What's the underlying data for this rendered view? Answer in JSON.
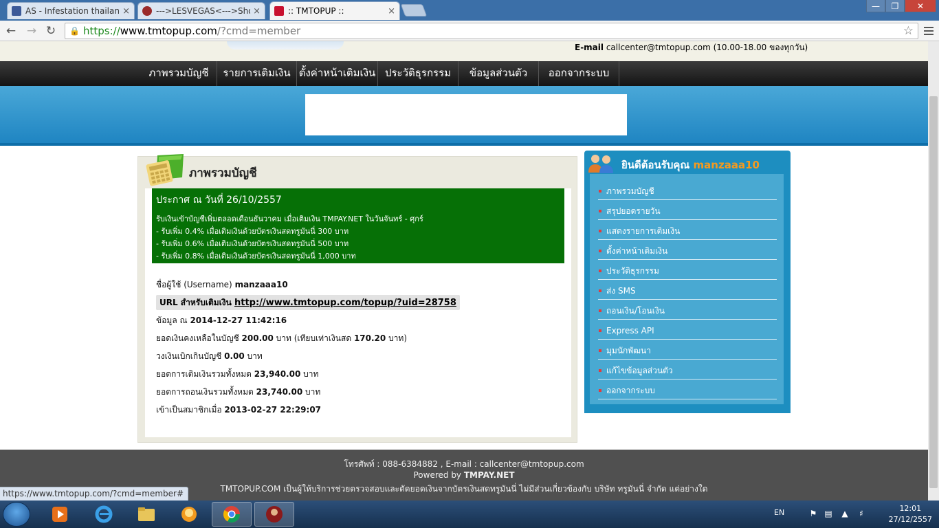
{
  "browser": {
    "tabs": [
      {
        "title": "AS - Infestation thailand",
        "favicon_color": "#3b5998",
        "active": false
      },
      {
        "title": "--->LESVEGAS<--->Sho",
        "favicon_color": "#9a2a2a",
        "active": false
      },
      {
        "title": ":: TMTOPUP ::",
        "favicon_color": "#c8102e",
        "active": true
      }
    ],
    "tab_close": "×",
    "window_buttons": {
      "minimize": "—",
      "maximize": "❐",
      "close": "✕"
    },
    "nav": {
      "back": "←",
      "forward": "→",
      "reload": "↻"
    },
    "url_scheme": "https://",
    "url_host": "www.tmtopup.com",
    "url_rest": "/?cmd=member",
    "star": "☆"
  },
  "header": {
    "email_label": "E-mail",
    "email_value": " callcenter@tmtopup.com (10.00-18.00 ของทุกวัน)"
  },
  "mainnav": [
    "ภาพรวมบัญชี",
    "รายการเติมเงิน",
    "ตั้งค่าหน้าเติมเงิน",
    "ประวัติธุรกรรม",
    "ข้อมูลส่วนตัว",
    "ออกจากระบบ"
  ],
  "overview": {
    "title": "ภาพรวมบัญชี",
    "announce": {
      "heading": "ประกาศ ณ วันที่ 26/10/2557",
      "lines": [
        "รับเงินเข้าบัญชีเพิ่มตลอดเดือนธันวาคม เมื่อเติมเงิน TMPAY.NET ในวันจันทร์ - ศุกร์",
        "- รับเพิ่ม 0.4% เมื่อเติมเงินด้วยบัตรเงินสดทรูมันนี่ 300 บาท",
        "- รับเพิ่ม 0.6% เมื่อเติมเงินด้วยบัตรเงินสดทรูมันนี่ 500 บาท",
        "- รับเพิ่ม 0.8% เมื่อเติมเงินด้วยบัตรเงินสดทรูมันนี่ 1,000 บาท"
      ]
    },
    "username_label": "ชื่อผู้ใช้ (Username) ",
    "username": "manzaaa10",
    "url_label": "URL สำหรับเติมเงิน ",
    "url_value": "http://www.tmtopup.com/topup/?uid=28758",
    "data_label": "ข้อมูล ณ ",
    "data_time": "2014-12-27 11:42:16",
    "balance_label": "ยอดเงินคงเหลือในบัญชี ",
    "balance_value": "200.00",
    "balance_unit": " บาท (เทียบเท่าเงินสด ",
    "balance_cash": "170.20",
    "balance_end": " บาท)",
    "overdraft_label": "วงเงินเบิกเกินบัญชี ",
    "overdraft_value": "0.00",
    "overdraft_unit": " บาท",
    "topup_label": "ยอดการเติมเงินรวมทั้งหมด ",
    "topup_value": "23,940.00",
    "topup_unit": " บาท",
    "withdraw_label": "ยอดการถอนเงินรวมทั้งหมด ",
    "withdraw_value": "23,740.00",
    "withdraw_unit": " บาท",
    "member_label": "เข้าเป็นสมาชิกเมื่อ ",
    "member_value": "2013-02-27 22:29:07"
  },
  "sidebar": {
    "welcome": "ยินดีต้อนรับคุณ ",
    "username": "manzaaa10",
    "items": [
      "ภาพรวมบัญชี",
      "สรุปยอดรายวัน",
      "แสดงรายการเติมเงิน",
      "ตั้งค่าหน้าเติมเงิน",
      "ประวัติธุรกรรม",
      "ส่ง SMS",
      "ถอนเงิน/โอนเงิน",
      "Express API",
      "มุมนักพัฒนา",
      "แก้ไขข้อมูลส่วนตัว",
      "ออกจากระบบ"
    ]
  },
  "footer": {
    "phone": "โทรศัพท์ : 088-6384882 , E-mail : callcenter@tmtopup.com",
    "powered_label": "Powered by ",
    "powered_brand": "TMPAY.NET",
    "disclaimer": "TMTOPUP.COM เป็นผู้ให้บริการช่วยตรวจสอบและตัดยอดเงินจากบัตรเงินสดทรูมันนี่ ไม่มีส่วนเกี่ยวข้องกับ บริษัท ทรูมันนี่ จำกัด แต่อย่างใด"
  },
  "status_url": "https://www.tmtopup.com/?cmd=member#",
  "taskbar": {
    "lang": "EN",
    "time": "12:01",
    "date": "27/12/2557"
  }
}
